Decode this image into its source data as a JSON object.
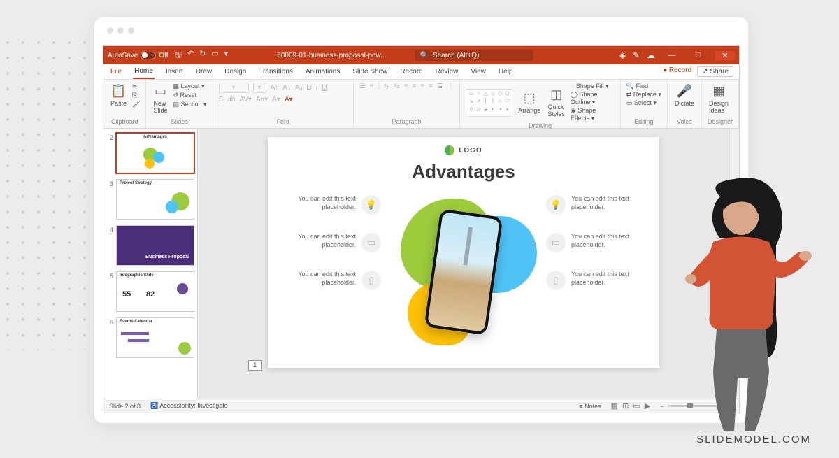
{
  "titlebar": {
    "autosave": "AutoSave",
    "autosave_state": "Off",
    "doc_title": "60009-01-business-proposal-pow...",
    "search_placeholder": "Search (Alt+Q)"
  },
  "tabs": {
    "file": "File",
    "home": "Home",
    "insert": "Insert",
    "draw": "Draw",
    "design": "Design",
    "transitions": "Transitions",
    "animations": "Animations",
    "slideshow": "Slide Show",
    "record_tab": "Record",
    "review": "Review",
    "view": "View",
    "help": "Help",
    "record_btn": "Record",
    "share": "Share"
  },
  "ribbon": {
    "clipboard": {
      "label": "Clipboard",
      "paste": "Paste"
    },
    "slides": {
      "label": "Slides",
      "new_slide": "New\nSlide",
      "layout": "Layout",
      "reset": "Reset",
      "section": "Section"
    },
    "font": {
      "label": "Font"
    },
    "paragraph": {
      "label": "Paragraph"
    },
    "drawing": {
      "label": "Drawing",
      "arrange": "Arrange",
      "quick": "Quick\nStyles",
      "fill": "Shape Fill",
      "outline": "Shape Outline",
      "effects": "Shape Effects"
    },
    "editing": {
      "label": "Editing",
      "find": "Find",
      "replace": "Replace",
      "select": "Select"
    },
    "voice": {
      "label": "Voice",
      "dictate": "Dictate"
    },
    "designer": {
      "label": "Designer",
      "ideas": "Design\nIdeas"
    }
  },
  "thumbs": [
    {
      "n": "2",
      "title": "Advantages"
    },
    {
      "n": "3",
      "title": "Project Strategy"
    },
    {
      "n": "4",
      "title": "Business Proposal"
    },
    {
      "n": "5",
      "title": "Infographic Slide",
      "a": "55",
      "b": "82"
    },
    {
      "n": "6",
      "title": "Events Calendar"
    }
  ],
  "slide": {
    "logo": "LOGO",
    "title": "Advantages",
    "placeholder_text": "You can edit this text placeholder.",
    "page_num": "1"
  },
  "status": {
    "slide_pos": "Slide 2 of 8",
    "accessibility": "Accessibility: Investigate",
    "notes": "Notes"
  },
  "watermark": "SLIDEMODEL.COM"
}
